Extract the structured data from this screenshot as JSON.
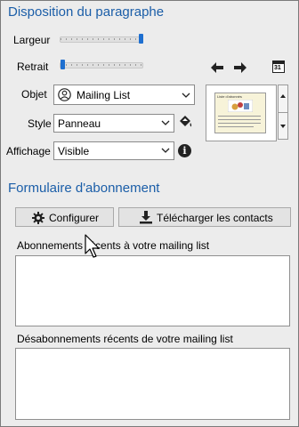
{
  "paragraph": {
    "title": "Disposition du paragraphe",
    "width_label": "Largeur",
    "width_value": 1.0,
    "indent_label": "Retrait",
    "indent_value": 0.0,
    "object_label": "Objet",
    "object_value": "Mailing List",
    "style_label": "Style",
    "style_value": "Panneau",
    "display_label": "Affichage",
    "display_value": "Visible"
  },
  "preview": {
    "caption": "Liste d'abonnés"
  },
  "form": {
    "title": "Formulaire d'abonnement",
    "configure_label": "Configurer",
    "download_label": "Télécharger les contacts",
    "recent_subs_label": "Abonnements récents à votre mailing list",
    "recent_unsubs_label": "Désabonnements récents de votre mailing list"
  },
  "icons": {
    "arrow_left": "arrow-left-icon",
    "arrow_right": "arrow-right-icon",
    "calendar": "calendar-icon",
    "calendar_day": "31",
    "paint_bucket": "paint-bucket-icon",
    "info": "info-icon",
    "gear": "gear-icon",
    "download": "download-icon",
    "person": "person-icon"
  },
  "colors": {
    "accent": "#1b5ea8",
    "slider_thumb": "#1e6fd0"
  }
}
